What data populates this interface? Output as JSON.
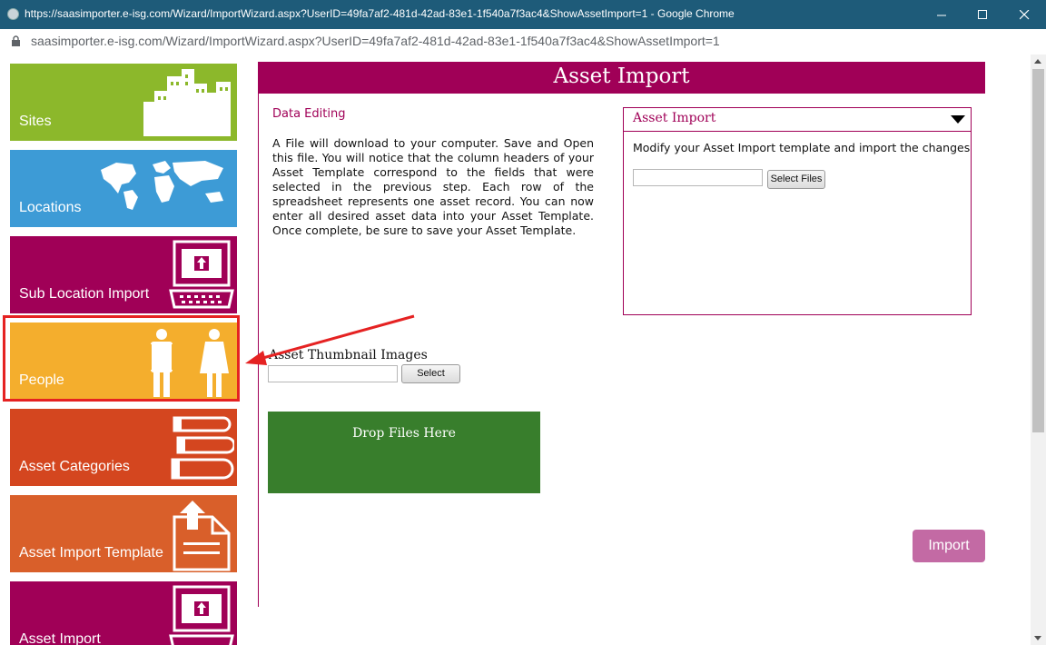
{
  "browser": {
    "window_title": "https://saasimporter.e-isg.com/Wizard/ImportWizard.aspx?UserID=49fa7af2-481d-42ad-83e1-1f540a7f3ac4&ShowAssetImport=1 - Google Chrome",
    "url": "saasimporter.e-isg.com/Wizard/ImportWizard.aspx?UserID=49fa7af2-481d-42ad-83e1-1f540a7f3ac4&ShowAssetImport=1"
  },
  "sidebar": {
    "items": [
      {
        "label": "Sites",
        "color": "#8cb82b",
        "icon": "buildings-icon"
      },
      {
        "label": "Locations",
        "color": "#3d9bd6",
        "icon": "world-map-icon"
      },
      {
        "label": "Sub Location Import",
        "color": "#a00057",
        "icon": "computer-upload-icon"
      },
      {
        "label": "People",
        "color": "#f4ae2d",
        "icon": "people-icon"
      },
      {
        "label": "Asset Categories",
        "color": "#d4461f",
        "icon": "books-icon"
      },
      {
        "label": "Asset Import Template",
        "color": "#d95f2a",
        "icon": "document-upload-icon"
      },
      {
        "label": "Asset Import",
        "color": "#a00057",
        "icon": "computer-upload-icon"
      }
    ],
    "highlighted": "People"
  },
  "main": {
    "title": "Asset Import",
    "section_title": "Data Editing",
    "description": "A File will download to your computer. Save and Open this file. You will notice that the column headers of your Asset Template correspond to the fields that were selected in the previous step. Each row of the spreadsheet represents one asset record. You can now enter all desired asset data into your Asset Template. Once complete, be sure to save your Asset Template.",
    "panel": {
      "title": "Asset Import",
      "description": "Modify your Asset Import template and import the changes",
      "file_value": "",
      "select_files_label": "Select Files"
    },
    "thumbnails": {
      "label": "Asset Thumbnail Images",
      "file_value": "",
      "select_label": "Select"
    },
    "dropzone_label": "Drop Files Here",
    "import_label": "Import"
  },
  "colors": {
    "accent": "#a00057",
    "dropzone": "#387e2c",
    "import_button": "#c36aa4",
    "highlight": "#e52222"
  }
}
